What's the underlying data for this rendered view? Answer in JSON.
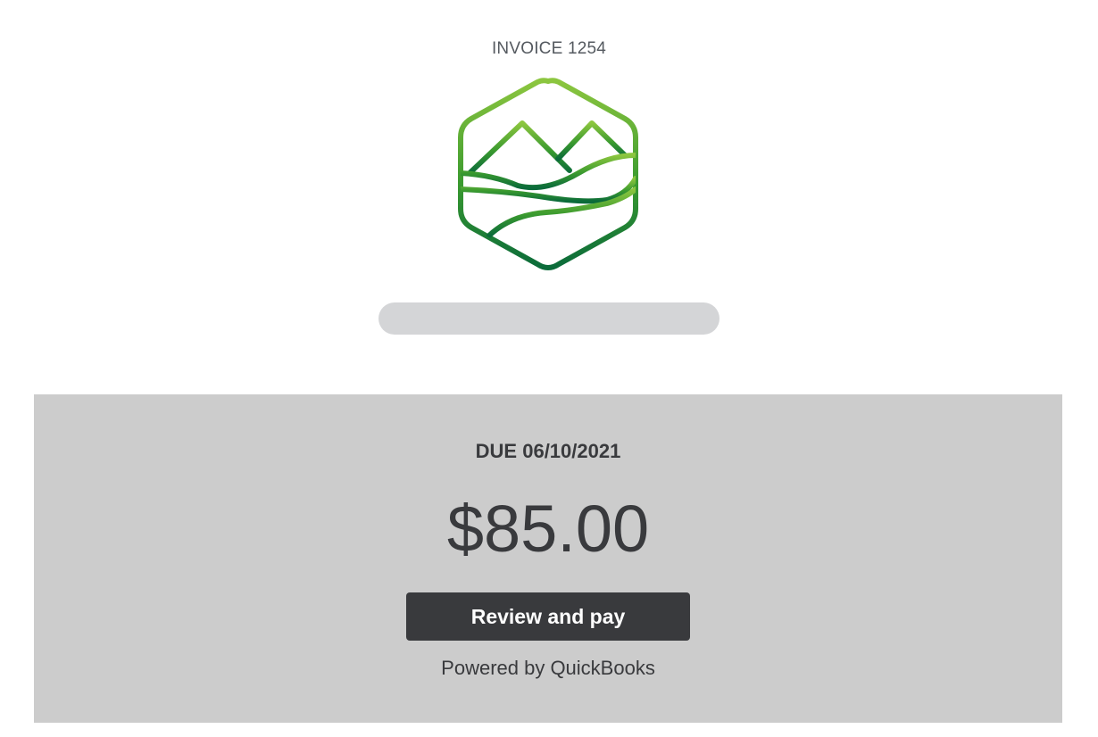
{
  "invoice": {
    "label": "INVOICE 1254"
  },
  "logo": {
    "icon": "mountain-landscape-hexagon-icon",
    "gradient_top": "#8cc63f",
    "gradient_bottom": "#0b6b3a"
  },
  "due": {
    "date_label": "DUE 06/10/2021",
    "amount": "$85.00",
    "pay_button_label": "Review and pay",
    "powered_by": "Powered by QuickBooks"
  },
  "colors": {
    "panel_background": "#cccccc",
    "button_background": "#393a3d",
    "button_text": "#ffffff",
    "text_dark": "#393a3d",
    "redaction": "#d4d5d7"
  }
}
